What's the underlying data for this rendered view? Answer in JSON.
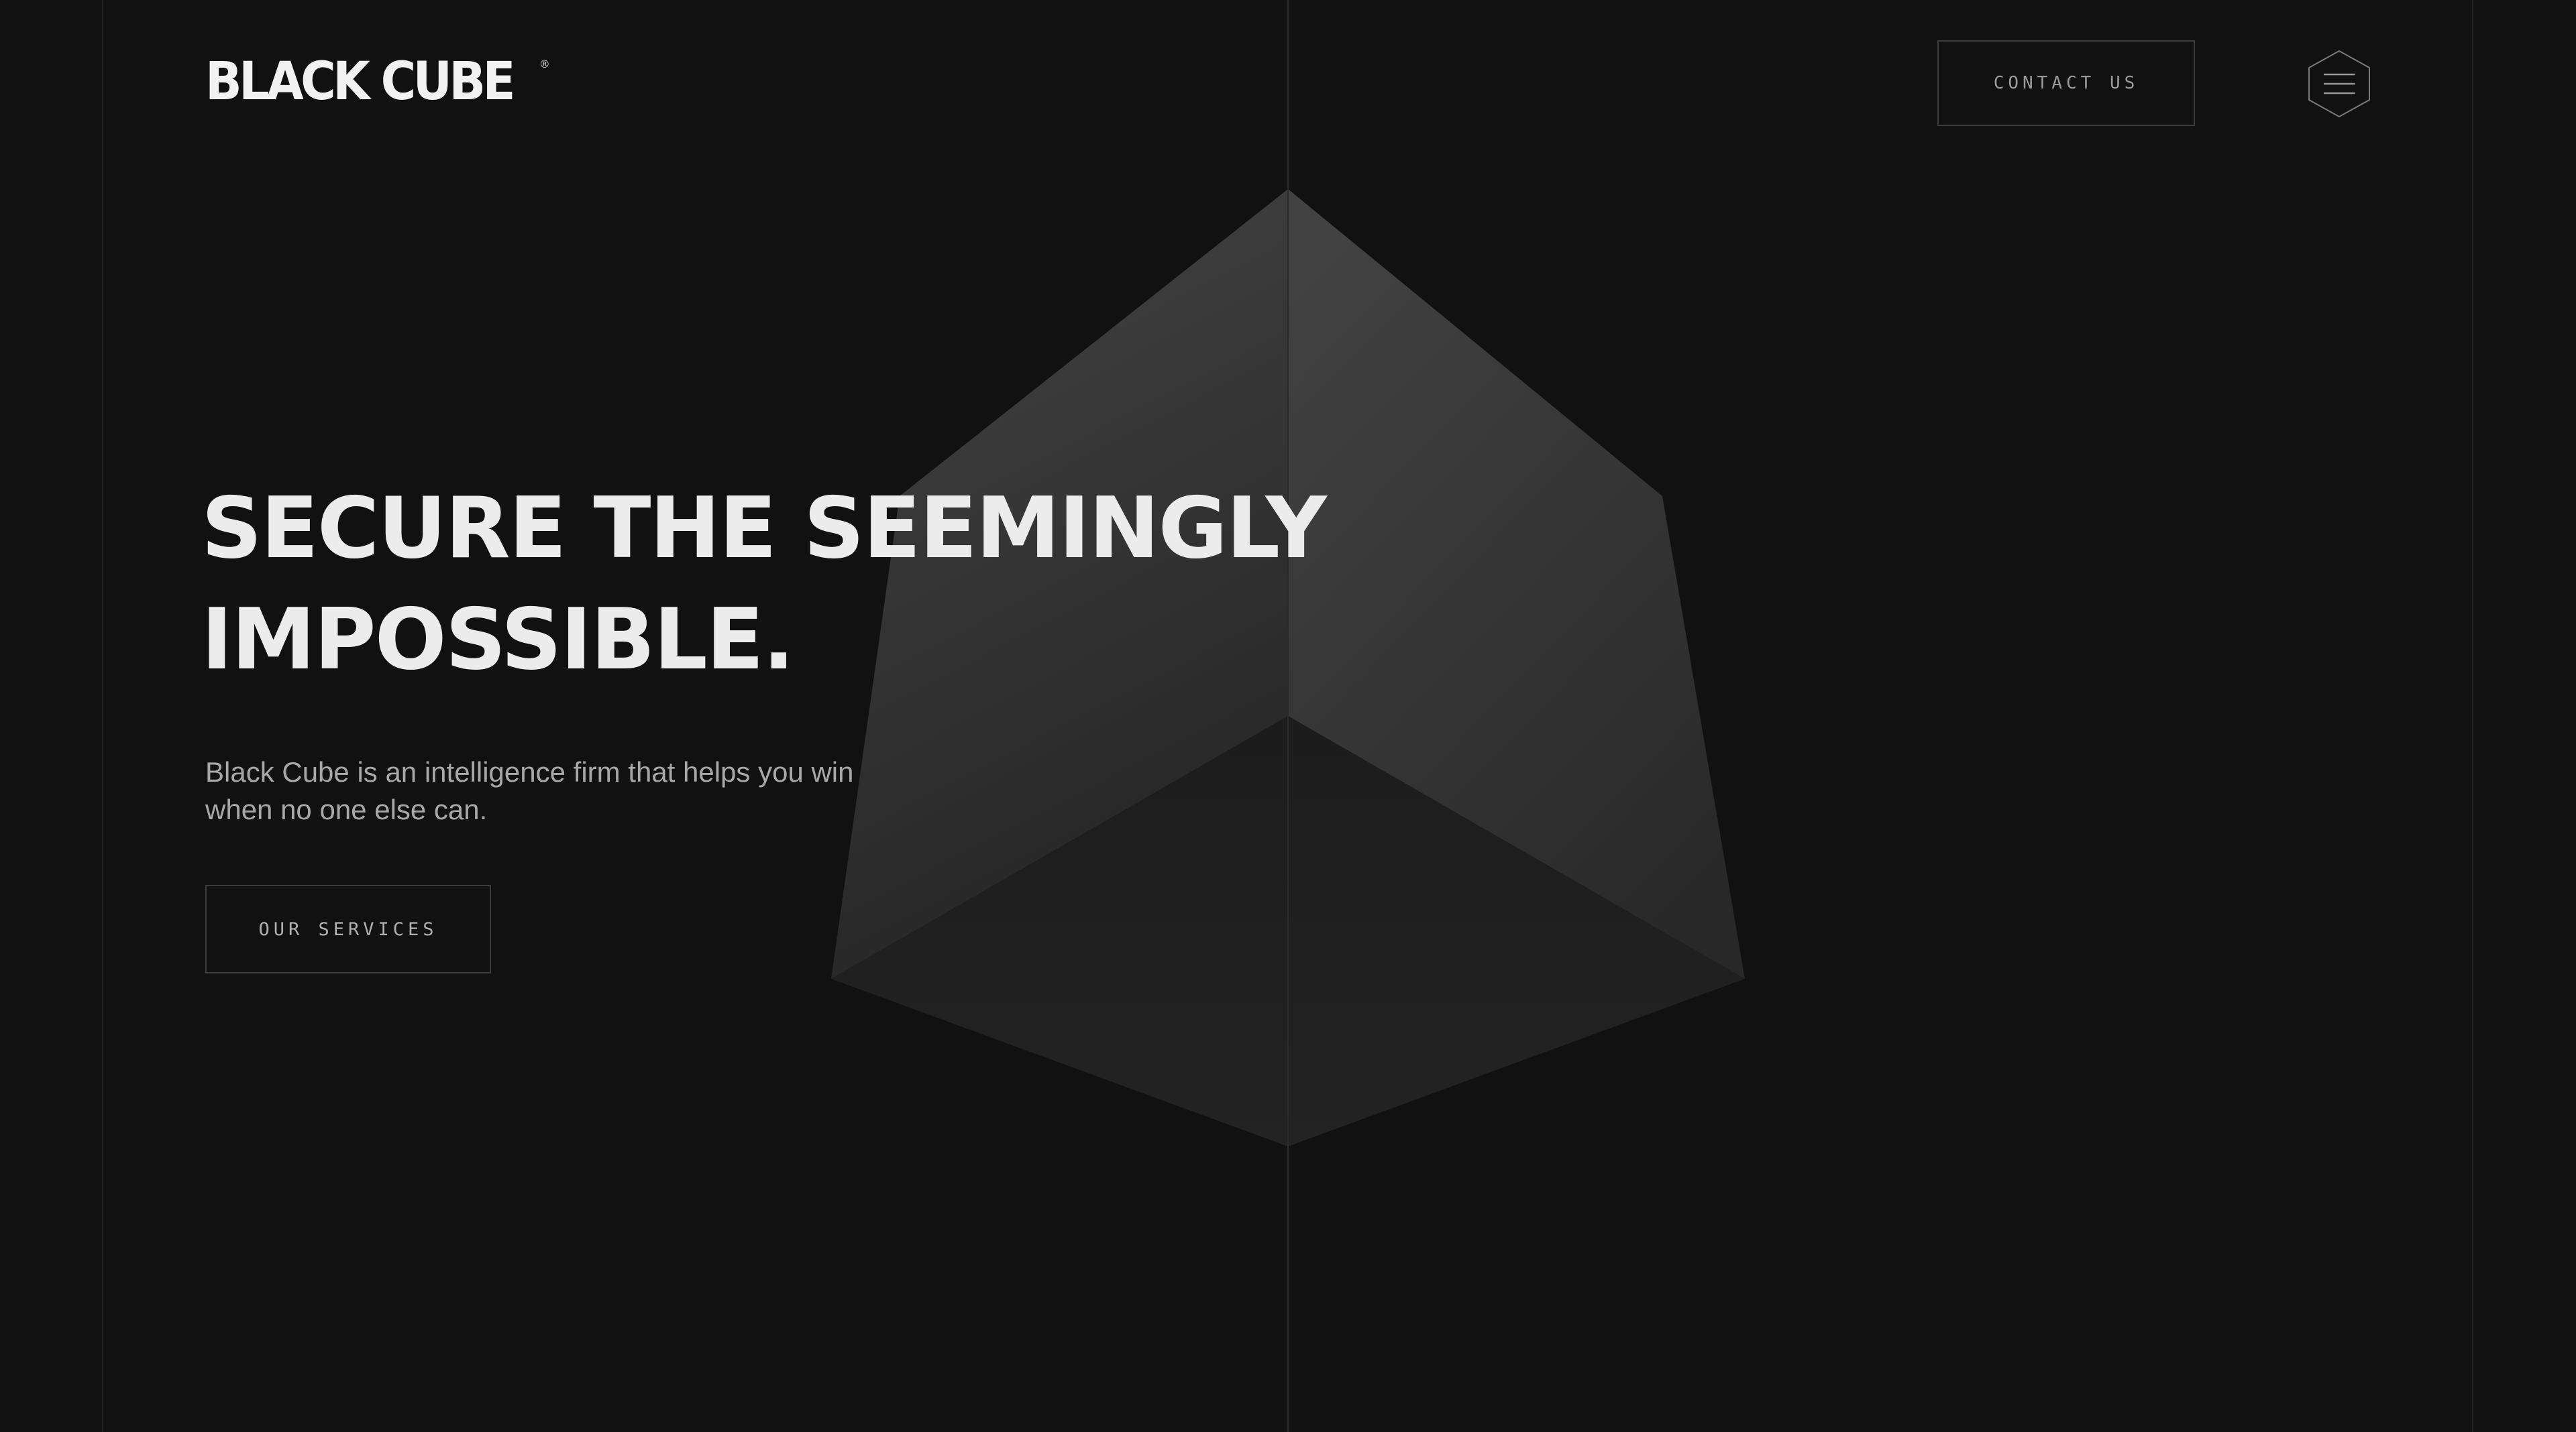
{
  "brand": {
    "logo_text": "BLACK CUBE",
    "registered_mark": "®"
  },
  "header": {
    "contact_label": "CONTACT US"
  },
  "hero": {
    "headline_line1": "SECURE THE SEEMINGLY",
    "headline_line2": "IMPOSSIBLE.",
    "description_line1": "Black Cube is an intelligence firm that helps you win",
    "description_line2": "when no one else can.",
    "cta_label": "OUR SERVICES"
  },
  "icons": {
    "menu": "hamburger-hexagon-icon",
    "hero_graphic": "cube-icon"
  },
  "colors": {
    "background": "#111111",
    "text_primary": "#ececec",
    "text_secondary": "#a8a8a8",
    "border": "#3c3c3c"
  }
}
